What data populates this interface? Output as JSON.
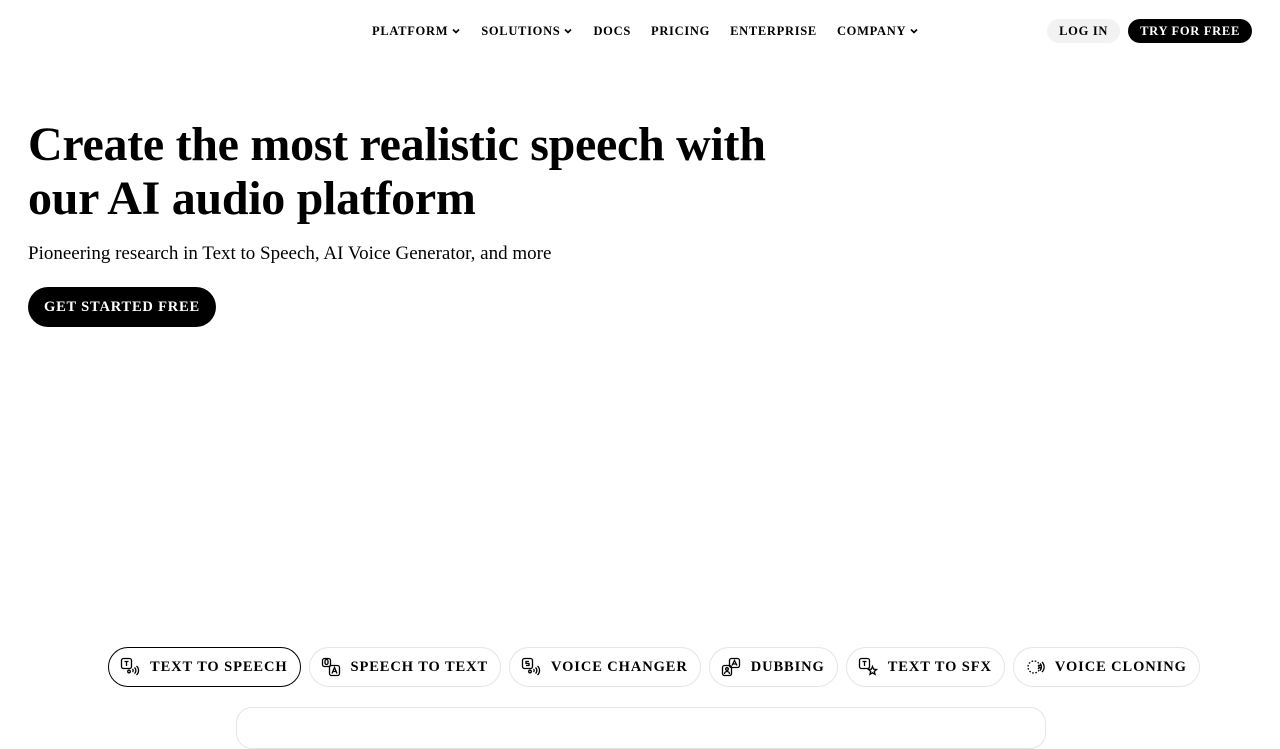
{
  "nav": {
    "links": [
      {
        "label": "PLATFORM",
        "has_dropdown": true
      },
      {
        "label": "SOLUTIONS",
        "has_dropdown": true
      },
      {
        "label": "DOCS",
        "has_dropdown": false
      },
      {
        "label": "PRICING",
        "has_dropdown": false
      },
      {
        "label": "ENTERPRISE",
        "has_dropdown": false
      },
      {
        "label": "COMPANY",
        "has_dropdown": true
      }
    ],
    "login_label": "LOG IN",
    "try_label": "TRY FOR FREE"
  },
  "hero": {
    "title_line1": "Create the most realistic speech with",
    "title_line2": "our AI audio platform",
    "subtitle": "Pioneering research in Text to Speech, AI Voice Generator, and more",
    "cta_label": "GET STARTED FREE"
  },
  "tabs": [
    {
      "label": "TEXT TO SPEECH",
      "icon": "text-to-speech-icon",
      "active": true
    },
    {
      "label": "SPEECH TO TEXT",
      "icon": "speech-to-text-icon",
      "active": false
    },
    {
      "label": "VOICE CHANGER",
      "icon": "voice-changer-icon",
      "active": false
    },
    {
      "label": "DUBBING",
      "icon": "dubbing-icon",
      "active": false
    },
    {
      "label": "TEXT TO SFX",
      "icon": "text-to-sfx-icon",
      "active": false
    },
    {
      "label": "VOICE CLONING",
      "icon": "voice-cloning-icon",
      "active": false
    }
  ],
  "colors": {
    "background": "#ffffff",
    "text": "#000000",
    "primary_button": "#000000",
    "secondary_button": "#f2f2f2",
    "border": "#e5e5e5"
  }
}
